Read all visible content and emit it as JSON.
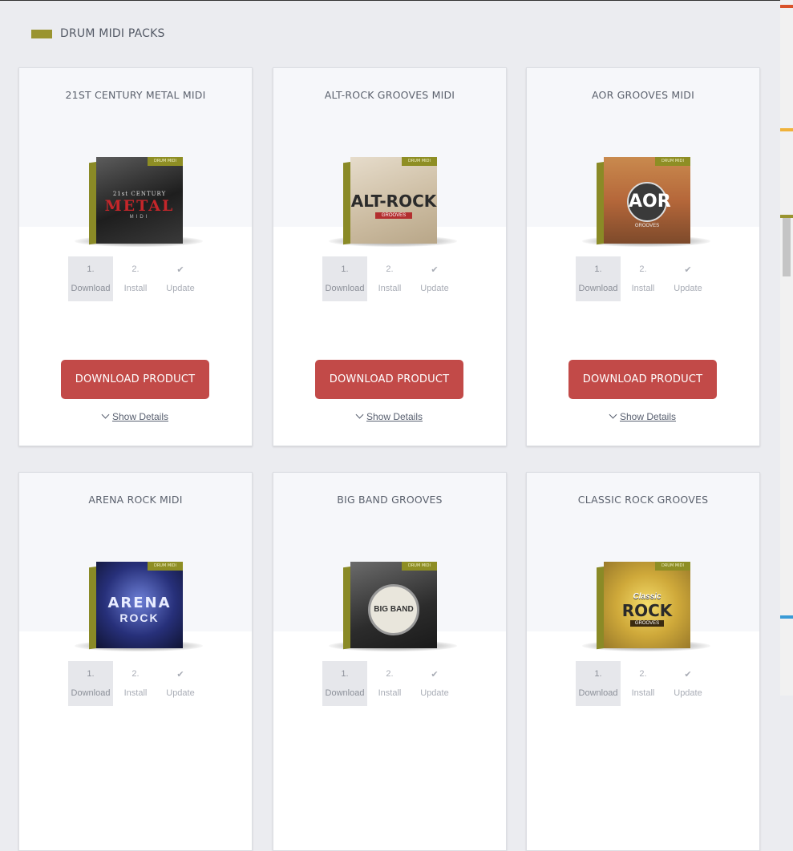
{
  "section": {
    "title": "DRUM MIDI PACKS",
    "accent": "#9a9430"
  },
  "steps": [
    {
      "num": "1.",
      "label": "Download"
    },
    {
      "num": "2.",
      "label": "Install"
    },
    {
      "num": "✔",
      "label": "Update"
    }
  ],
  "download_label": "DOWNLOAD PRODUCT",
  "show_details_label": "Show Details",
  "box_band_text": "DRUM MIDI",
  "products": [
    {
      "title": "21ST CENTURY METAL MIDI",
      "art_main": "METAL",
      "art_top": "21st CENTURY",
      "art_sub": "MIDI"
    },
    {
      "title": "ALT-ROCK GROOVES MIDI",
      "art_main": "ALT-ROCK",
      "art_top": "",
      "art_sub": "GROOVES"
    },
    {
      "title": "AOR GROOVES MIDI",
      "art_main": "AOR",
      "art_top": "",
      "art_sub": "GROOVES"
    },
    {
      "title": "ARENA ROCK MIDI",
      "art_main": "ARENA",
      "art_top": "",
      "art_sub": "ROCK"
    },
    {
      "title": "BIG BAND GROOVES",
      "art_main": "BIG BAND",
      "art_top": "",
      "art_sub": ""
    },
    {
      "title": "CLASSIC ROCK GROOVES",
      "art_main": "ROCK",
      "art_top": "Classic",
      "art_sub": "GROOVES"
    }
  ],
  "colors": {
    "button": "#c24a48",
    "background": "#ebecf0"
  }
}
